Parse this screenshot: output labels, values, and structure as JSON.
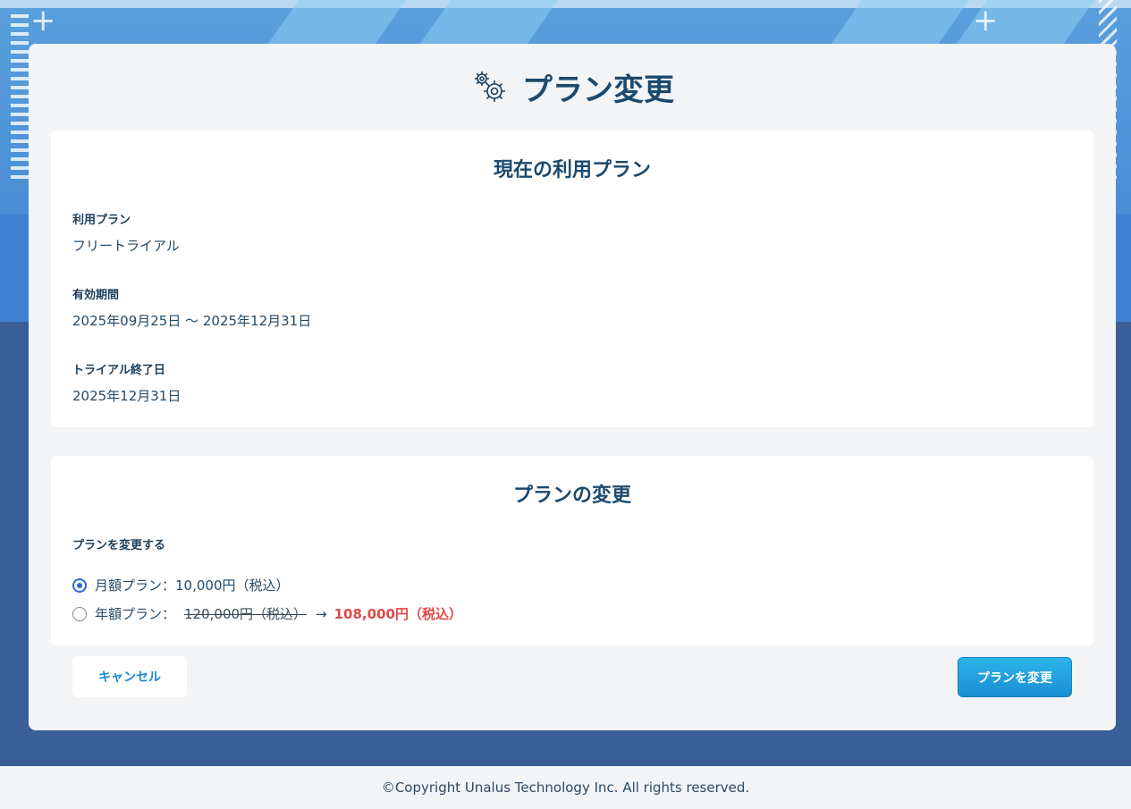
{
  "page": {
    "title": "プラン変更",
    "title_icon": "gears-icon"
  },
  "current_plan": {
    "heading": "現在の利用プラン",
    "fields": [
      {
        "label": "利用プラン",
        "value": "フリートライアル"
      },
      {
        "label": "有効期間",
        "value": "2025年09月25日 〜 2025年12月31日"
      },
      {
        "label": "トライアル終了日",
        "value": "2025年12月31日"
      }
    ]
  },
  "plan_change": {
    "heading": "プランの変更",
    "label": "プランを変更する",
    "options": [
      {
        "label": "月額プラン：10,000円（税込）",
        "checked": true
      },
      {
        "label": "年額プラン：",
        "original_price": "120,000円（税込）",
        "arrow": "→",
        "discount_price": "108,000円（税込）",
        "checked": false
      }
    ]
  },
  "actions": {
    "cancel_label": "キャンセル",
    "submit_label": "プランを変更"
  },
  "footer": {
    "copyright": "©Copyright Unalus Technology Inc. All rights reserved."
  },
  "colors": {
    "accent": "#1a8ed3",
    "discount": "#e04a4a",
    "radio_checked": "#2a66d9"
  }
}
